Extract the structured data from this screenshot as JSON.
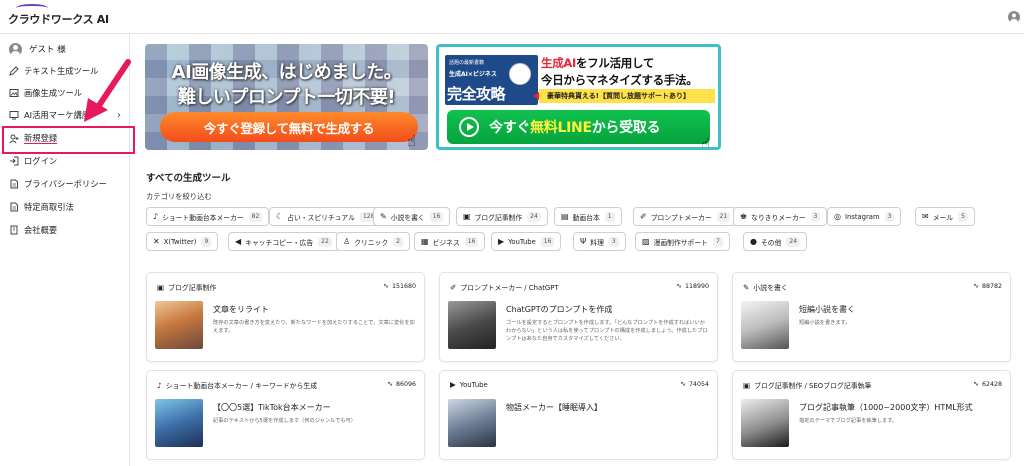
{
  "app": {
    "logo_text": "クラウドワークス AI"
  },
  "sidebar": {
    "user": "ゲスト 様",
    "items": [
      {
        "label": "テキスト生成ツール",
        "icon": "pen-icon"
      },
      {
        "label": "画像生成ツール",
        "icon": "image-icon"
      },
      {
        "label": "AI活用マーケ講座",
        "icon": "video-icon",
        "chevron": "›"
      },
      {
        "label": "新規登録",
        "icon": "user-plus-icon"
      },
      {
        "label": "ログイン",
        "icon": "login-icon"
      },
      {
        "label": "プライバシーポリシー",
        "icon": "document-icon"
      },
      {
        "label": "特定商取引法",
        "icon": "document-icon"
      },
      {
        "label": "会社概要",
        "icon": "building-icon"
      }
    ]
  },
  "banners": {
    "b1": {
      "line1": "AI画像生成、はじめました。",
      "line2": "難しいプロンプト一切不要!",
      "cta": "今すぐ登録して無料で生成する"
    },
    "b2": {
      "left_small": "話題の最新書籍",
      "left_mid": "生成AI×ビジネス",
      "left_big": "完全攻略",
      "title1_red": "生成AI",
      "title1_rest": "をフル活用して",
      "title2": "今日からマネタイズする手法。",
      "badge": "豪華特典貰える!【質問し放題サポートあり】",
      "cta_a": "今すぐ",
      "cta_b": "無料LINE",
      "cta_c": "から受取る"
    }
  },
  "main": {
    "section_title": "すべての生成ツール",
    "filter_label": "カテゴリを絞り込む",
    "chips": [
      {
        "icon": "♪",
        "label": "ショート動画台本メーカー",
        "count": "82"
      },
      {
        "icon": "☾",
        "label": "占い・スピリチュアル",
        "count": "128"
      },
      {
        "icon": "✎",
        "label": "小説を書く",
        "count": "16"
      },
      {
        "icon": "▣",
        "label": "ブログ記事制作",
        "count": "24"
      },
      {
        "icon": "▤",
        "label": "動画台本",
        "count": "1"
      },
      {
        "icon": "✐",
        "label": "プロンプトメーカー",
        "count": "21"
      },
      {
        "icon": "♚",
        "label": "なりきりメーカー",
        "count": "3"
      },
      {
        "icon": "◎",
        "label": "Instagram",
        "count": "3"
      },
      {
        "icon": "✉",
        "label": "メール",
        "count": "5"
      },
      {
        "icon": "✕",
        "label": "X(Twitter)",
        "count": "9"
      },
      {
        "icon": "◀",
        "label": "キャッチコピー・広告",
        "count": "22"
      },
      {
        "icon": "♙",
        "label": "クリニック",
        "count": "2"
      },
      {
        "icon": "▦",
        "label": "ビジネス",
        "count": "16"
      },
      {
        "icon": "▶",
        "label": "YouTube",
        "count": "16"
      },
      {
        "icon": "Ψ",
        "label": "料理",
        "count": "3"
      },
      {
        "icon": "▧",
        "label": "漫画制作サポート",
        "count": "7"
      },
      {
        "icon": "●",
        "label": "その他",
        "count": "24"
      }
    ],
    "cards": [
      {
        "icon": "▣",
        "category": "ブログ記事制作",
        "count": "151680",
        "title": "文章をリライト",
        "desc": "既存の文章の書き方を変えたり、新たなワードを加えたりすることで、文章に変化を加えます。"
      },
      {
        "icon": "✐",
        "category": "プロンプトメーカー / ChatGPT",
        "count": "118990",
        "title": "ChatGPTのプロンプトを作成",
        "desc": "ゴールを設定するとプロンプトを作成します。「どんなプロンプトを作成すればいいかわからない」という人は私を使ってプロンプトの構成を作成しましょう。作成したプロンプトはあなた自身でカスタマイズしてください。"
      },
      {
        "icon": "✎",
        "category": "小説を書く",
        "count": "88782",
        "title": "短編小説を書く",
        "desc": "短編小説を書きます。"
      },
      {
        "icon": "♪",
        "category": "ショート動画台本メーカー / キーワードから生成",
        "count": "86096",
        "title": "【〇〇5選】TikTok台本メーカー",
        "desc": "記事のテキストから5選を作成します（何のジャンルでも可）"
      },
      {
        "icon": "▶",
        "category": "YouTube",
        "count": "74054",
        "title": "物語メーカー【睡眠導入】",
        "desc": ""
      },
      {
        "icon": "▣",
        "category": "ブログ記事制作 / SEOブログ記事執筆",
        "count": "62428",
        "title": "ブログ記事執筆（1000~2000文字）HTML形式",
        "desc": "指定のテーマでブログ記事を執筆します。"
      }
    ]
  },
  "colors": {
    "accent": "#e8195b",
    "line_green": "#06a33d",
    "banner_orange": "#f24d1c",
    "banner2_border": "#3cc1ca"
  }
}
